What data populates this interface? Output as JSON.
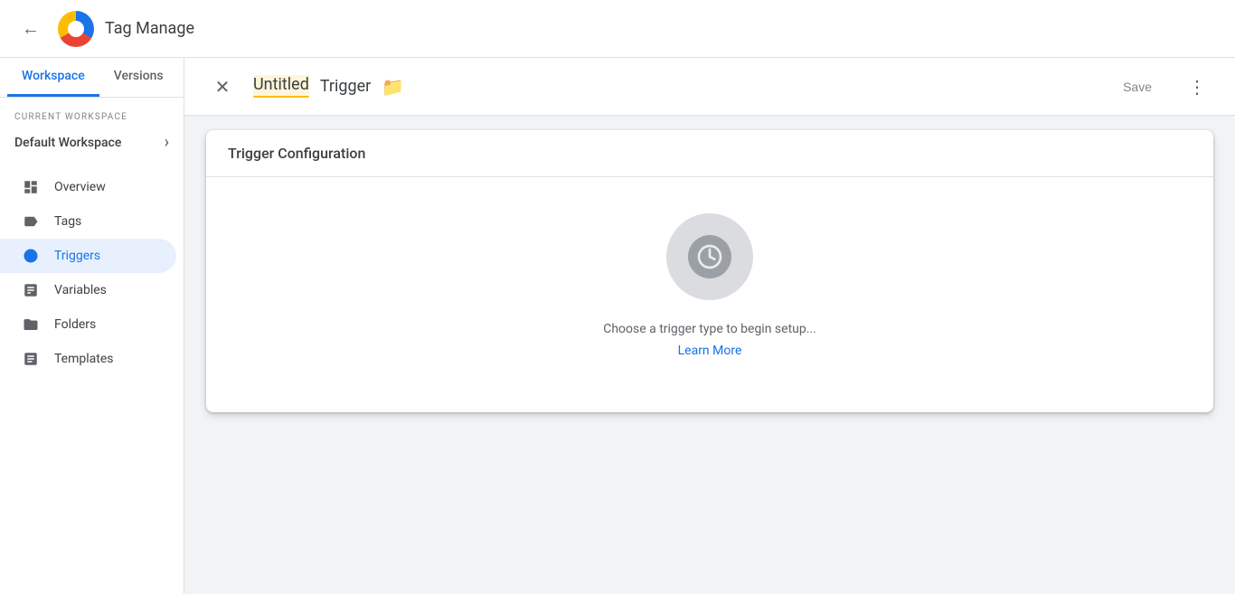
{
  "app": {
    "title": "Tag Manage",
    "back_label": "←"
  },
  "tabs": {
    "workspace_label": "Workspace",
    "versions_label": "Versions"
  },
  "sidebar": {
    "current_workspace_label": "CURRENT WORKSPACE",
    "workspace_name": "Default Workspace",
    "nav_items": [
      {
        "id": "overview",
        "label": "Overview",
        "icon": "overview"
      },
      {
        "id": "tags",
        "label": "Tags",
        "icon": "tags"
      },
      {
        "id": "triggers",
        "label": "Triggers",
        "icon": "triggers",
        "active": true
      },
      {
        "id": "variables",
        "label": "Variables",
        "icon": "variables"
      },
      {
        "id": "folders",
        "label": "Folders",
        "icon": "folders"
      },
      {
        "id": "templates",
        "label": "Templates",
        "icon": "templates"
      }
    ]
  },
  "dialog": {
    "close_label": "✕",
    "title_untitled": "Untitled",
    "title_trigger": "Trigger",
    "folder_icon": "📁",
    "save_label": "Save",
    "more_icon": "⋮"
  },
  "trigger_config": {
    "section_title": "Trigger Configuration",
    "hint_text": "Choose a trigger type to begin setup...",
    "learn_more_label": "Learn More"
  }
}
